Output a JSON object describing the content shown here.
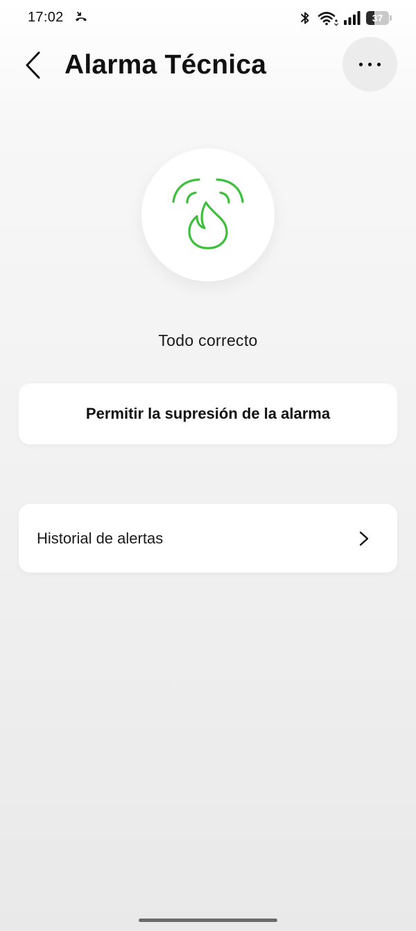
{
  "status_bar": {
    "time": "17:02",
    "battery_level": "37",
    "battery_fraction": 0.37
  },
  "header": {
    "title": "Alarma Técnica"
  },
  "hero": {
    "status": "Todo correcto",
    "icon": "alarm-flame-icon",
    "accent_color": "#3cc03c"
  },
  "actions": {
    "suppress_label": "Permitir la supresión de la alarma"
  },
  "history": {
    "label": "Historial de alertas"
  },
  "icons": {
    "back": "chevron-left-icon",
    "more": "more-dots-icon",
    "history_chevron": "chevron-right-icon",
    "call": "call-forward-icon",
    "bluetooth": "bluetooth-icon",
    "wifi": "wifi-icon",
    "signal": "signal-icon",
    "battery": "battery-icon"
  }
}
